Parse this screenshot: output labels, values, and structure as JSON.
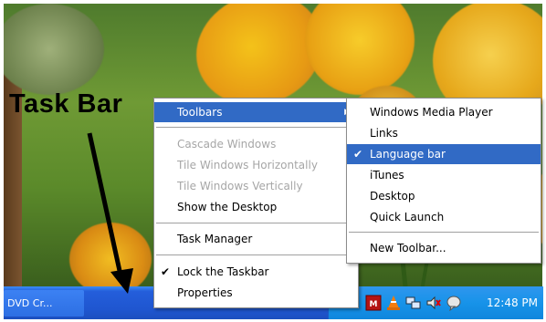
{
  "annotation": {
    "label": "Task Bar"
  },
  "taskbar": {
    "task_button": "DVD Cr...",
    "clock": "12:48 PM",
    "colors": {
      "taskbar_blue": "#245edb",
      "tray_blue": "#1793e9",
      "highlight": "#316ac5"
    },
    "tray_icons": [
      "mcafee-icon",
      "cone-icon",
      "network-icon",
      "volume-icon",
      "messenger-icon"
    ]
  },
  "context_menu": {
    "toolbars": "Toolbars",
    "cascade": "Cascade Windows",
    "tile_h": "Tile Windows Horizontally",
    "tile_v": "Tile Windows Vertically",
    "show_desktop": "Show the Desktop",
    "task_manager": "Task Manager",
    "lock": "Lock the Taskbar",
    "properties": "Properties"
  },
  "submenu": {
    "wmp": "Windows Media Player",
    "links": "Links",
    "language": "Language bar",
    "itunes": "iTunes",
    "desktop": "Desktop",
    "quick_launch": "Quick Launch",
    "new_toolbar": "New Toolbar..."
  },
  "glyphs": {
    "check": "✔",
    "submenu_arrow": "▶"
  }
}
